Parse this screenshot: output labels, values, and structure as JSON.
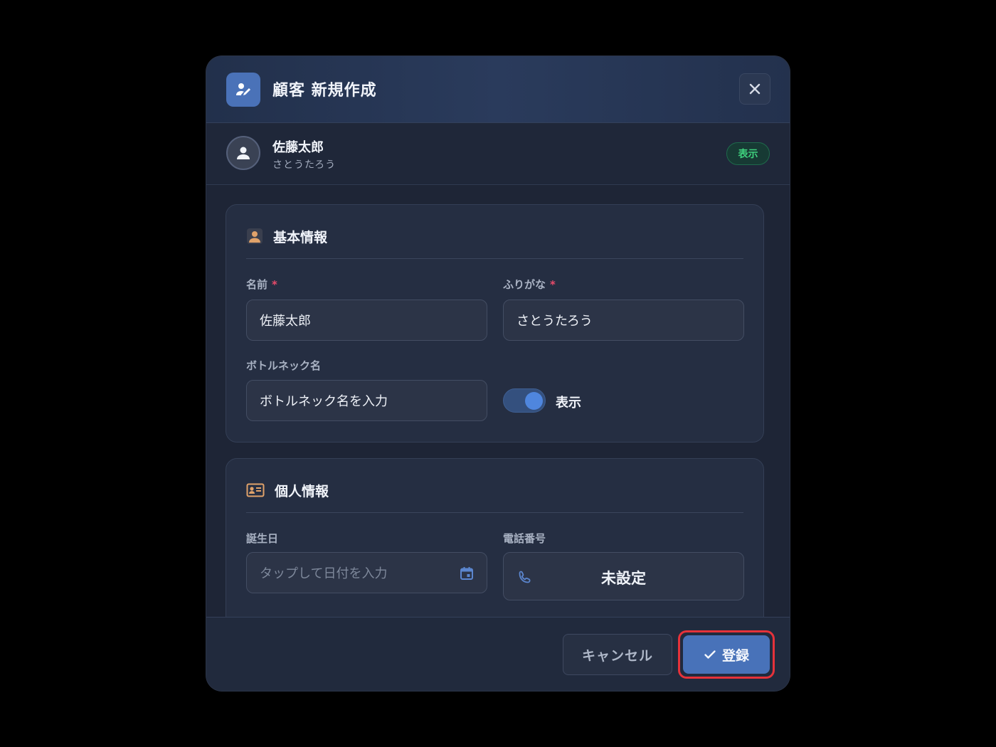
{
  "header": {
    "title": "顧客 新規作成",
    "icon": "user-edit-icon",
    "close_icon": "close-icon"
  },
  "customer": {
    "name": "佐藤太郎",
    "kana": "さとうたろう",
    "badge": "表示",
    "avatar_icon": "user-icon"
  },
  "basic_info": {
    "title": "基本情報",
    "icon": "person-icon",
    "name_label": "名前",
    "name_required": "*",
    "name_value": "佐藤太郎",
    "kana_label": "ふりがな",
    "kana_required": "*",
    "kana_value": "さとうたろう",
    "bottle_label": "ボトルネック名",
    "bottle_placeholder": "ボトルネック名を入力",
    "toggle_label": "表示",
    "toggle_on": true
  },
  "personal_info": {
    "title": "個人情報",
    "icon": "id-card-icon",
    "birthday_label": "誕生日",
    "birthday_placeholder": "タップして日付を入力",
    "phone_label": "電話番号",
    "phone_value": "未設定"
  },
  "footer": {
    "cancel_label": "キャンセル",
    "submit_label": "登録"
  },
  "colors": {
    "accent": "#4872b9",
    "badge_green": "#3fd27e",
    "required": "#e94b6b",
    "highlight": "#e5323a"
  }
}
